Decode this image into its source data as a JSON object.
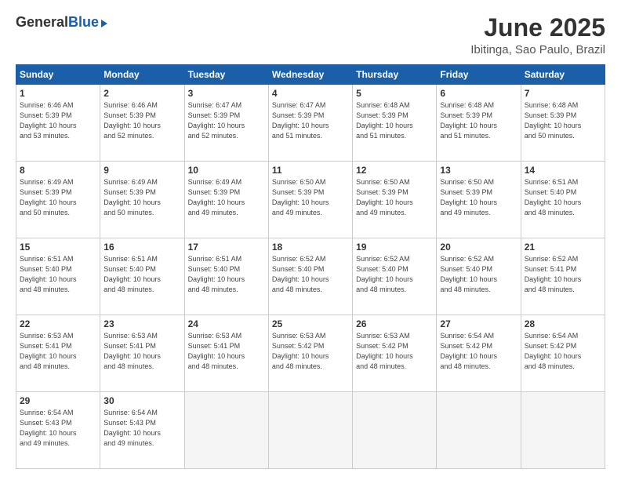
{
  "header": {
    "logo_general": "General",
    "logo_blue": "Blue",
    "title": "June 2025",
    "location": "Ibitinga, Sao Paulo, Brazil"
  },
  "calendar": {
    "days_of_week": [
      "Sunday",
      "Monday",
      "Tuesday",
      "Wednesday",
      "Thursday",
      "Friday",
      "Saturday"
    ],
    "weeks": [
      [
        {
          "day": "1",
          "info": "Sunrise: 6:46 AM\nSunset: 5:39 PM\nDaylight: 10 hours\nand 53 minutes."
        },
        {
          "day": "2",
          "info": "Sunrise: 6:46 AM\nSunset: 5:39 PM\nDaylight: 10 hours\nand 52 minutes."
        },
        {
          "day": "3",
          "info": "Sunrise: 6:47 AM\nSunset: 5:39 PM\nDaylight: 10 hours\nand 52 minutes."
        },
        {
          "day": "4",
          "info": "Sunrise: 6:47 AM\nSunset: 5:39 PM\nDaylight: 10 hours\nand 51 minutes."
        },
        {
          "day": "5",
          "info": "Sunrise: 6:48 AM\nSunset: 5:39 PM\nDaylight: 10 hours\nand 51 minutes."
        },
        {
          "day": "6",
          "info": "Sunrise: 6:48 AM\nSunset: 5:39 PM\nDaylight: 10 hours\nand 51 minutes."
        },
        {
          "day": "7",
          "info": "Sunrise: 6:48 AM\nSunset: 5:39 PM\nDaylight: 10 hours\nand 50 minutes."
        }
      ],
      [
        {
          "day": "8",
          "info": "Sunrise: 6:49 AM\nSunset: 5:39 PM\nDaylight: 10 hours\nand 50 minutes."
        },
        {
          "day": "9",
          "info": "Sunrise: 6:49 AM\nSunset: 5:39 PM\nDaylight: 10 hours\nand 50 minutes."
        },
        {
          "day": "10",
          "info": "Sunrise: 6:49 AM\nSunset: 5:39 PM\nDaylight: 10 hours\nand 49 minutes."
        },
        {
          "day": "11",
          "info": "Sunrise: 6:50 AM\nSunset: 5:39 PM\nDaylight: 10 hours\nand 49 minutes."
        },
        {
          "day": "12",
          "info": "Sunrise: 6:50 AM\nSunset: 5:39 PM\nDaylight: 10 hours\nand 49 minutes."
        },
        {
          "day": "13",
          "info": "Sunrise: 6:50 AM\nSunset: 5:39 PM\nDaylight: 10 hours\nand 49 minutes."
        },
        {
          "day": "14",
          "info": "Sunrise: 6:51 AM\nSunset: 5:40 PM\nDaylight: 10 hours\nand 48 minutes."
        }
      ],
      [
        {
          "day": "15",
          "info": "Sunrise: 6:51 AM\nSunset: 5:40 PM\nDaylight: 10 hours\nand 48 minutes."
        },
        {
          "day": "16",
          "info": "Sunrise: 6:51 AM\nSunset: 5:40 PM\nDaylight: 10 hours\nand 48 minutes."
        },
        {
          "day": "17",
          "info": "Sunrise: 6:51 AM\nSunset: 5:40 PM\nDaylight: 10 hours\nand 48 minutes."
        },
        {
          "day": "18",
          "info": "Sunrise: 6:52 AM\nSunset: 5:40 PM\nDaylight: 10 hours\nand 48 minutes."
        },
        {
          "day": "19",
          "info": "Sunrise: 6:52 AM\nSunset: 5:40 PM\nDaylight: 10 hours\nand 48 minutes."
        },
        {
          "day": "20",
          "info": "Sunrise: 6:52 AM\nSunset: 5:40 PM\nDaylight: 10 hours\nand 48 minutes."
        },
        {
          "day": "21",
          "info": "Sunrise: 6:52 AM\nSunset: 5:41 PM\nDaylight: 10 hours\nand 48 minutes."
        }
      ],
      [
        {
          "day": "22",
          "info": "Sunrise: 6:53 AM\nSunset: 5:41 PM\nDaylight: 10 hours\nand 48 minutes."
        },
        {
          "day": "23",
          "info": "Sunrise: 6:53 AM\nSunset: 5:41 PM\nDaylight: 10 hours\nand 48 minutes."
        },
        {
          "day": "24",
          "info": "Sunrise: 6:53 AM\nSunset: 5:41 PM\nDaylight: 10 hours\nand 48 minutes."
        },
        {
          "day": "25",
          "info": "Sunrise: 6:53 AM\nSunset: 5:42 PM\nDaylight: 10 hours\nand 48 minutes."
        },
        {
          "day": "26",
          "info": "Sunrise: 6:53 AM\nSunset: 5:42 PM\nDaylight: 10 hours\nand 48 minutes."
        },
        {
          "day": "27",
          "info": "Sunrise: 6:54 AM\nSunset: 5:42 PM\nDaylight: 10 hours\nand 48 minutes."
        },
        {
          "day": "28",
          "info": "Sunrise: 6:54 AM\nSunset: 5:42 PM\nDaylight: 10 hours\nand 48 minutes."
        }
      ],
      [
        {
          "day": "29",
          "info": "Sunrise: 6:54 AM\nSunset: 5:43 PM\nDaylight: 10 hours\nand 49 minutes."
        },
        {
          "day": "30",
          "info": "Sunrise: 6:54 AM\nSunset: 5:43 PM\nDaylight: 10 hours\nand 49 minutes."
        },
        {
          "day": "",
          "info": ""
        },
        {
          "day": "",
          "info": ""
        },
        {
          "day": "",
          "info": ""
        },
        {
          "day": "",
          "info": ""
        },
        {
          "day": "",
          "info": ""
        }
      ]
    ]
  }
}
